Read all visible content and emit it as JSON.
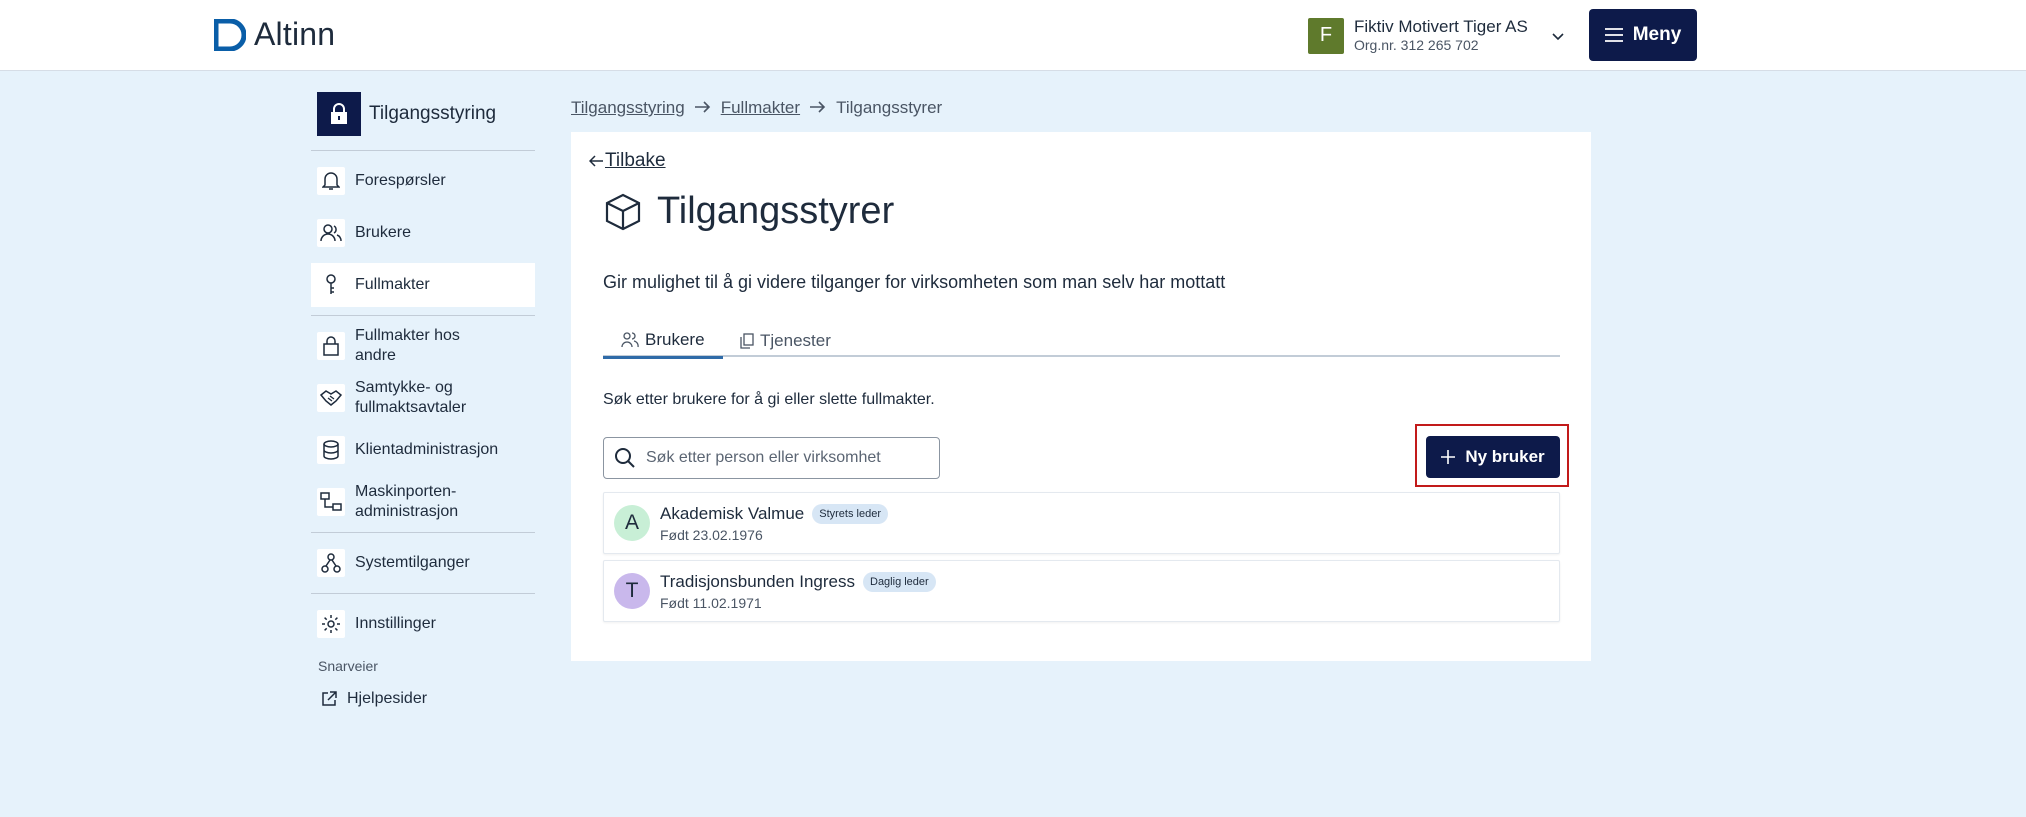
{
  "header": {
    "logo_text": "Altinn",
    "org": {
      "avatar_letter": "F",
      "name": "Fiktiv Motivert Tiger AS",
      "orgnr": "Org.nr. 312 265 702",
      "avatar_color": "#5f7a2c"
    },
    "menu_label": "Meny"
  },
  "sidebar": {
    "title": "Tilgangsstyring",
    "items": [
      {
        "label": "Forespørsler",
        "icon": "bell-icon"
      },
      {
        "label": "Brukere",
        "icon": "users-icon"
      },
      {
        "label": "Fullmakter",
        "icon": "key-icon",
        "active": true
      },
      {
        "label": "Fullmakter hos andre",
        "icon": "padlock-icon"
      },
      {
        "label": "Samtykke- og fullmaktsavtaler",
        "icon": "handshake-icon"
      },
      {
        "label": "Klientadministrasjon",
        "icon": "database-icon"
      },
      {
        "label": "Maskinporten-administrasjon",
        "icon": "network-icon"
      },
      {
        "label": "Systemtilganger",
        "icon": "system-icon"
      },
      {
        "label": "Innstillinger",
        "icon": "gear-icon"
      }
    ],
    "shortcuts_label": "Snarveier",
    "help_label": "Hjelpesider"
  },
  "breadcrumb": [
    "Tilgangsstyring",
    "Fullmakter",
    "Tilgangsstyrer"
  ],
  "main": {
    "back_label": "Tilbake",
    "title": "Tilgangsstyrer",
    "description": "Gir mulighet til å gi videre tilganger for virksomheten som man selv har mottatt",
    "tabs": [
      {
        "label": "Brukere",
        "active": true
      },
      {
        "label": "Tjenester",
        "active": false
      }
    ],
    "hint": "Søk etter brukere for å gi eller slette fullmakter.",
    "search_placeholder": "Søk etter person eller virksomhet",
    "new_user_label": "Ny bruker",
    "users": [
      {
        "initial": "A",
        "name": "Akademisk Valmue",
        "role": "Styrets leder",
        "born": "Født 23.02.1976",
        "avatar_color": "#c8efd6"
      },
      {
        "initial": "T",
        "name": "Tradisjonsbunden Ingress",
        "role": "Daglig leder",
        "born": "Født 11.02.1971",
        "avatar_color": "#c9b8ec"
      }
    ]
  },
  "colors": {
    "accent": "#0d1a4a",
    "page_bg": "#e6f2fb",
    "highlight": "#c21a1a"
  }
}
